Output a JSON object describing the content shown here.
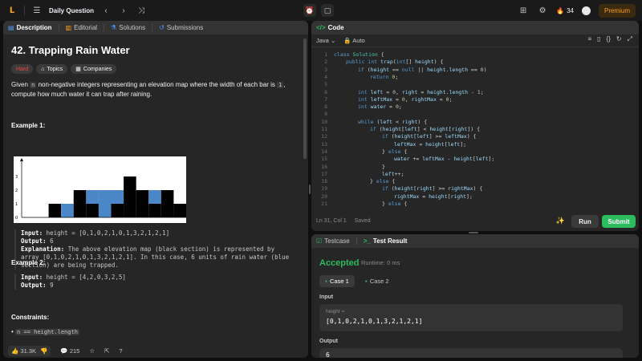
{
  "topnav": {
    "title": "Daily Question",
    "streak": "34",
    "premium": "Premium"
  },
  "left_tabs": [
    "Description",
    "Editorial",
    "Solutions",
    "Submissions"
  ],
  "problem": {
    "title": "42. Trapping Rain Water",
    "tags": [
      "Hard",
      "Topics",
      "Companies"
    ],
    "desc_pre": "Given ",
    "desc_n": "n",
    "desc_mid": " non-negative integers representing an elevation map where the width of each bar is ",
    "desc_one": "1",
    "desc_post": ", compute how much water it can trap after raining.",
    "example1_title": "Example 1:",
    "ex1_input_label": "Input:",
    "ex1_input": " height = [0,1,0,2,1,0,1,3,2,1,2,1]",
    "ex1_output_label": "Output:",
    "ex1_output": " 6",
    "ex1_expl_label": "Explanation:",
    "ex1_expl": " The above elevation map (black section) is represented by array [0,1,0,2,1,0,1,3,2,1,2,1]. In this case, 6 units of rain water (blue section) are being trapped.",
    "example2_title": "Example 2:",
    "ex2_input_label": "Input:",
    "ex2_input": " height = [4,2,0,3,2,5]",
    "ex2_output_label": "Output:",
    "ex2_output": " 9",
    "constraints_title": "Constraints:",
    "constraint1": "n == height.length"
  },
  "chart_data": {
    "type": "bar",
    "heights": [
      0,
      1,
      0,
      2,
      1,
      0,
      1,
      3,
      2,
      1,
      2,
      1
    ],
    "water": [
      0,
      0,
      1,
      0,
      1,
      2,
      1,
      0,
      0,
      1,
      0,
      0
    ],
    "ylim": [
      0,
      4
    ],
    "yticks": [
      "0",
      "1",
      "2",
      "3"
    ],
    "bar_color": "#000000",
    "water_color": "#4a86c8"
  },
  "bottombar": {
    "likes": "31.3K",
    "comments": "215"
  },
  "code": {
    "tab": "Code",
    "language": "Java",
    "mode": "Auto",
    "status": "Ln 31, Col 1",
    "saved": "Saved",
    "run": "Run",
    "submit": "Submit",
    "lines": [
      {
        "n": "1",
        "t": "class Solution {",
        "i": 0
      },
      {
        "n": "2",
        "t": "public int trap(int[] height) {",
        "i": 1
      },
      {
        "n": "3",
        "t": "if (height == null || height.length == 0)",
        "i": 2
      },
      {
        "n": "4",
        "t": "return 0;",
        "i": 3
      },
      {
        "n": "5",
        "t": "",
        "i": 0
      },
      {
        "n": "6",
        "t": "int left = 0, right = height.length - 1;",
        "i": 2
      },
      {
        "n": "7",
        "t": "int leftMax = 0, rightMax = 0;",
        "i": 2
      },
      {
        "n": "8",
        "t": "int water = 0;",
        "i": 2
      },
      {
        "n": "9",
        "t": "",
        "i": 0
      },
      {
        "n": "10",
        "t": "while (left < right) {",
        "i": 2
      },
      {
        "n": "11",
        "t": "if (height[left] < height[right]) {",
        "i": 3
      },
      {
        "n": "12",
        "t": "if (height[left] >= leftMax) {",
        "i": 4
      },
      {
        "n": "13",
        "t": "leftMax = height[left];",
        "i": 5
      },
      {
        "n": "14",
        "t": "} else {",
        "i": 4
      },
      {
        "n": "15",
        "t": "water += leftMax - height[left];",
        "i": 5
      },
      {
        "n": "16",
        "t": "}",
        "i": 4
      },
      {
        "n": "17",
        "t": "left++;",
        "i": 4
      },
      {
        "n": "18",
        "t": "} else {",
        "i": 3
      },
      {
        "n": "19",
        "t": "if (height[right] >= rightMax) {",
        "i": 4
      },
      {
        "n": "20",
        "t": "rightMax = height[right];",
        "i": 5
      },
      {
        "n": "21",
        "t": "} else {",
        "i": 4
      }
    ]
  },
  "test": {
    "tabs": [
      "Testcase",
      "Test Result"
    ],
    "accepted": "Accepted",
    "runtime": "Runtime: 0 ms",
    "cases": [
      "Case 1",
      "Case 2"
    ],
    "input_label": "Input",
    "param_name": "height =",
    "param_value": "[0,1,0,2,1,0,1,3,2,1,2,1]",
    "output_label": "Output",
    "output_value": "6"
  }
}
